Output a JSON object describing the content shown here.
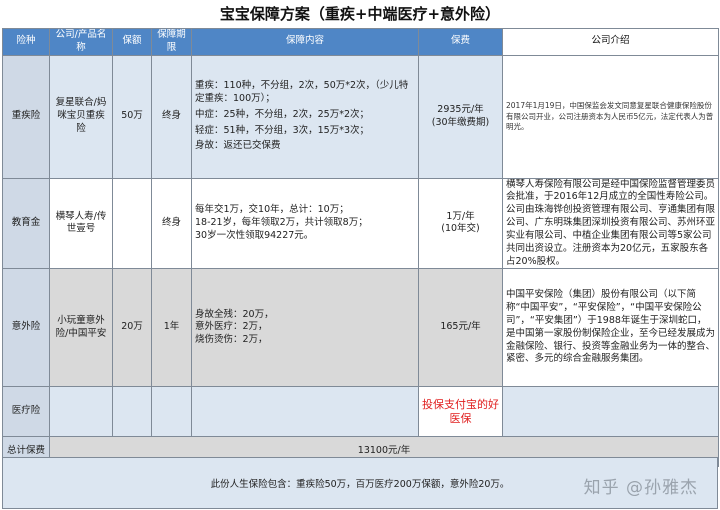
{
  "title": "宝宝保障方案（重疾+中端医疗+意外险）",
  "headers": {
    "kind": "险种",
    "product": "公司/产品名称",
    "amount": "保额",
    "term": "保障期限",
    "content": "保障内容",
    "premium": "保费",
    "intro": "公司介绍"
  },
  "rows": {
    "critical": {
      "kind": "重疾险",
      "product": "复星联合/妈咪宝贝重疾险",
      "amount": "50万",
      "term": "终身",
      "content": [
        "重疾：110种，不分组，2次，50万*2次，（少儿特定重疾：100万）；",
        "中症：25种，不分组，2次，25万*2次；",
        "轻症：51种，不分组，3次，15万*3次；",
        "身故：返还已交保费"
      ],
      "premium": "2935元/年",
      "premium_note": "(30年缴费期)",
      "intro": "2017年1月19日，中国保监会发文同意复星联合健康保险股份有限公司开业，公司注册资本为人民币5亿元，法定代表人为曾明光。"
    },
    "education": {
      "kind": "教育金",
      "product": "横琴人寿/传世壹号",
      "amount": "",
      "term": "终身",
      "content": [
        "每年交1万，交10年，总计：10万；",
        "18-21岁，每年领取2万，共计领取8万；",
        "30岁一次性领取94227元。"
      ],
      "premium": "1万/年",
      "premium_note": "(10年交)",
      "intro": "横琴人寿保险有限公司是经中国保险监督管理委员会批准，于2016年12月成立的全国性寿险公司。公司由珠海铧创投资管理有限公司、亨通集团有限公司、广东明珠集团深圳投资有限公司、苏州环亚实业有限公司、中植企业集团有限公司等5家公司共同出资设立。注册资本为20亿元，五家股东各占20%股权。"
    },
    "accident": {
      "kind": "意外险",
      "product": "小玩童意外险/中国平安",
      "amount": "20万",
      "term": "1年",
      "content": [
        "身故全残：20万，",
        "意外医疗：2万，",
        "烧伤烫伤：2万，"
      ],
      "premium": "165元/年",
      "intro": "中国平安保险（集团）股份有限公司（以下简称“中国平安”，“平安保险”，“中国平安保险公司”，“平安集团”）于1988年诞生于深圳蛇口，是中国第一家股份制保险企业，至今已经发展成为金融保险、银行、投资等金融业务为一体的整合、紧密、多元的综合金融服务集团。"
    },
    "medical": {
      "kind": "医疗险",
      "premium_note": "投保支付宝的好医保"
    }
  },
  "total": {
    "label": "总计保费",
    "value": "13100元/年"
  },
  "footer": "此份人生保险包含：重疾险50万，百万医疗200万保额，意外险20万。",
  "watermark": "知乎 @孙雅杰",
  "colors": {
    "header_blue": "#4f86c6",
    "row_blue": "#dce6f1",
    "row_gray": "#d9d9d9",
    "alert_red": "#e02020"
  }
}
